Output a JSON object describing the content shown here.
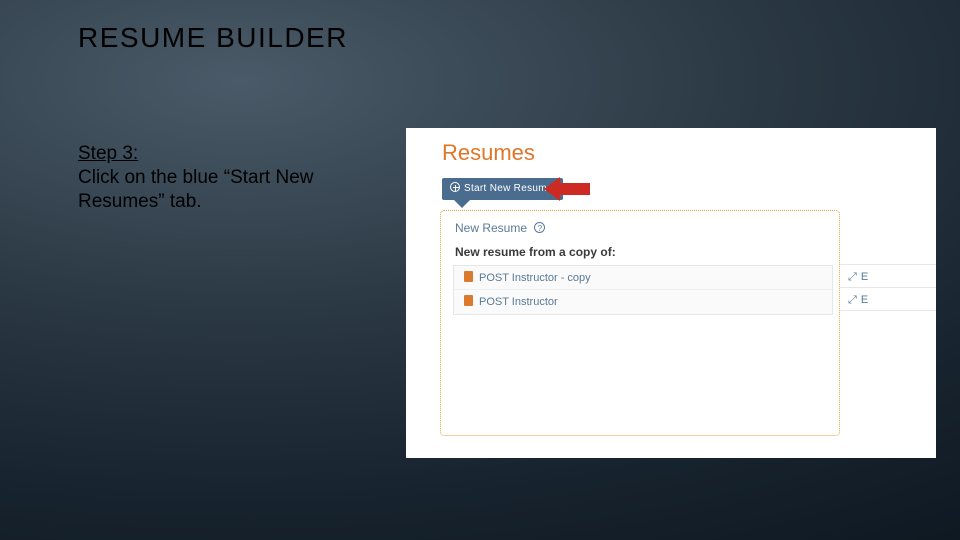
{
  "slide": {
    "title": "RESUME BUILDER",
    "step_label": "Step 3:",
    "step_text": "Click on the blue “Start New Resumes” tab."
  },
  "screenshot": {
    "heading": "Resumes",
    "start_button_label": "Start New Resume",
    "panel": {
      "new_resume_label": "New Resume",
      "copy_heading": "New resume from a copy of:",
      "items": [
        "POST Instructor - copy",
        "POST Instructor"
      ]
    },
    "right_actions": [
      "E",
      "E"
    ]
  }
}
